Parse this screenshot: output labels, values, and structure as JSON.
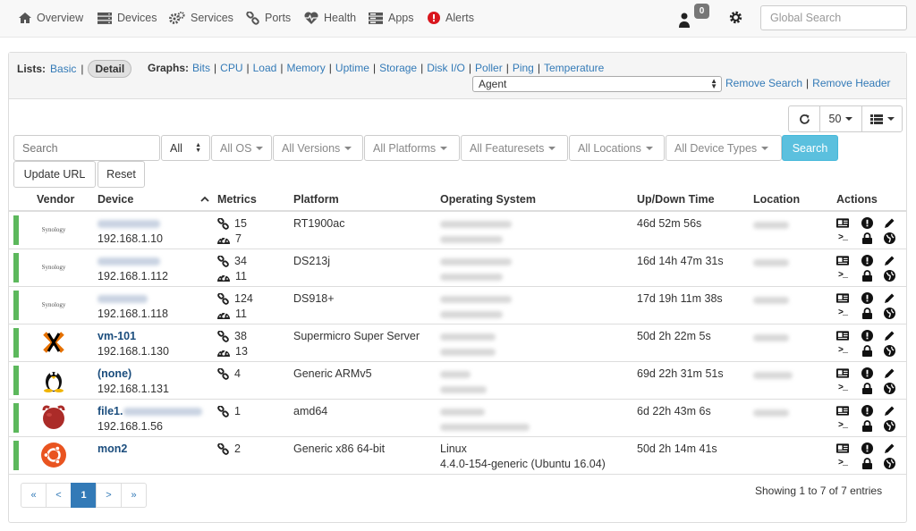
{
  "nav": {
    "items": [
      {
        "label": "Overview",
        "icon": "home-icon"
      },
      {
        "label": "Devices",
        "icon": "server-icon"
      },
      {
        "label": "Services",
        "icon": "cogs-icon"
      },
      {
        "label": "Ports",
        "icon": "link-icon"
      },
      {
        "label": "Health",
        "icon": "heartbeat-icon"
      },
      {
        "label": "Apps",
        "icon": "tasks-icon"
      },
      {
        "label": "Alerts",
        "icon": "exclamation-circle-icon"
      }
    ],
    "user_badge": "0",
    "search_placeholder": "Global Search"
  },
  "header": {
    "lists_label": "Lists:",
    "basic_label": "Basic",
    "detail_label": "Detail",
    "graphs_label": "Graphs:",
    "graph_links": [
      "Bits",
      "CPU",
      "Load",
      "Memory",
      "Uptime",
      "Storage",
      "Disk I/O",
      "Poller",
      "Ping",
      "Temperature"
    ],
    "agent_select": "Agent",
    "remove_search": "Remove Search",
    "remove_header": "Remove Header"
  },
  "toolbar": {
    "page_size": "50"
  },
  "filters": {
    "search_placeholder": "Search",
    "state_select": "All",
    "os": "All OS",
    "versions": "All Versions",
    "platforms": "All Platforms",
    "featuresets": "All Featuresets",
    "locations": "All Locations",
    "device_types": "All Device Types",
    "search_button": "Search",
    "update_url": "Update URL",
    "reset": "Reset"
  },
  "table": {
    "columns": [
      "Vendor",
      "Device",
      "Metrics",
      "Platform",
      "Operating System",
      "Up/Down Time",
      "Location",
      "Actions"
    ],
    "rows": [
      {
        "vendor": "Synology",
        "vendor_icon": "synology-logo",
        "name": "",
        "ip": "192.168.1.10",
        "ports": "15",
        "health": "7",
        "platform": "RT1900ac",
        "os": "",
        "os_detail": "",
        "uptime": "46d 52m 56s"
      },
      {
        "vendor": "Synology",
        "vendor_icon": "synology-logo",
        "name": "",
        "ip": "192.168.1.112",
        "ports": "34",
        "health": "11",
        "platform": "DS213j",
        "os": "",
        "os_detail": "",
        "uptime": "16d 14h 47m 31s"
      },
      {
        "vendor": "Synology",
        "vendor_icon": "synology-logo",
        "name": "",
        "ip": "192.168.1.118",
        "ports": "124",
        "health": "11",
        "platform": "DS918+",
        "os": "",
        "os_detail": "",
        "uptime": "17d 19h 11m 38s"
      },
      {
        "vendor": "",
        "vendor_icon": "proxmox-logo",
        "name": "vm-101",
        "ip": "192.168.1.130",
        "ports": "38",
        "health": "13",
        "platform": "Supermicro Super Server",
        "os": "",
        "os_detail": "",
        "uptime": "50d 2h 22m 5s"
      },
      {
        "vendor": "",
        "vendor_icon": "linux-tux-logo",
        "name": "(none)",
        "ip": "192.168.1.131",
        "ports": "4",
        "health": "",
        "platform": "Generic ARMv5",
        "os": "",
        "os_detail": "",
        "uptime": "69d 22h 31m 51s"
      },
      {
        "vendor": "",
        "vendor_icon": "freebsd-logo",
        "name": "file1.",
        "ip": "192.168.1.56",
        "ports": "1",
        "health": "",
        "platform": "amd64",
        "os": "",
        "os_detail": "",
        "uptime": "6d 22h 43m 6s"
      },
      {
        "vendor": "",
        "vendor_icon": "ubuntu-logo",
        "name": "mon2",
        "ip": "",
        "ports": "2",
        "health": "",
        "platform": "Generic x86 64-bit",
        "os": "Linux",
        "os_detail": "4.4.0-154-generic (Ubuntu 16.04)",
        "uptime": "50d 2h 14m 41s"
      }
    ]
  },
  "pagination": {
    "first": "«",
    "prev": "<",
    "current": "1",
    "next": ">",
    "last": "»",
    "showing": "Showing 1 to 7 of 7 entries"
  }
}
